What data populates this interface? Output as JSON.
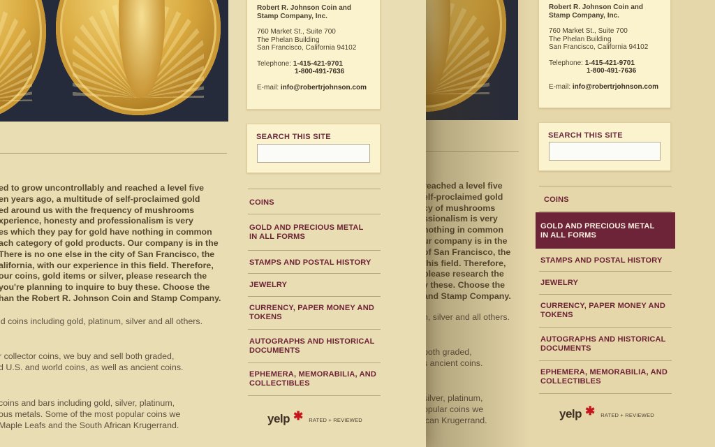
{
  "contact": {
    "company": "Robert R. Johnson Coin and Stamp Company, Inc.",
    "address_line1": "760 Market St., Suite 700",
    "address_line2": "The Phelan Building",
    "address_line3": "San Francisco, California 94102",
    "telephone_label": "Telephone:",
    "phone1": "1-415-421-9701",
    "phone2": "1-800-491-7636",
    "email_label": "E-mail:",
    "email": "info@robertrjohnson.com"
  },
  "search": {
    "title": "SEARCH THIS SITE",
    "placeholder": ""
  },
  "nav": {
    "items": [
      {
        "line1": "COINS",
        "line2": ""
      },
      {
        "line1": "GOLD AND PRECIOUS METAL",
        "line2": "IN ALL FORMS"
      },
      {
        "line1": "STAMPS AND POSTAL HISTORY",
        "line2": ""
      },
      {
        "line1": "JEWELRY",
        "line2": ""
      },
      {
        "line1": "CURRENCY, PAPER MONEY AND",
        "line2": "TOKENS"
      },
      {
        "line1": "AUTOGRAPHS AND HISTORICAL",
        "line2": "DOCUMENTS"
      },
      {
        "line1": "EPHEMERA, MEMORABILIA, AND",
        "line2": "COLLECTIBLES"
      }
    ],
    "active_index_right": 1
  },
  "yelp": {
    "logo_text": "yelp",
    "burst": "✱",
    "tag": "RATED + REVIEWED"
  },
  "left_body": {
    "para1": [
      "ed to grow uncontrollably and reached a level five",
      "en years ago, a multitude of self-proclaimed gold",
      "ed around us with the frequency of mushrooms",
      "xperience, honesty and professionalism is very",
      "es which they pay for gold have nothing in common",
      "ach category of gold products. Our company is in the",
      "There is no one else in the city of San Francisco, the",
      "alifornia, with our experience in this field. Therefore,",
      "our coins, gold items or silver, please research the",
      "you're planning to inquire to buy these. Choose the",
      "han the Robert R. Johnson Coin and Stamp Company."
    ],
    "para2": [
      "ld coins including gold, platinum, silver and all others."
    ],
    "para3": [
      "r collector coins, we buy and sell both graded,",
      "d U.S. and world coins, as well as ancient coins."
    ],
    "para4": [
      "coins and bars including gold, silver, platinum,",
      "ous metals. Some of the most popular coins we",
      "Maple Leafs and the South African Krugerrand."
    ]
  },
  "right_body": {
    "para1": [
      "reached a level five",
      "elf-proclaimed gold",
      "cy of mushrooms",
      "ssionalism is very",
      "nothing in common",
      "ur company is in the",
      "of San Francisco, the",
      "this field. Therefore,",
      "please research the",
      "y these. Choose the",
      "and Stamp Company."
    ],
    "para2": [
      "n, silver and all others."
    ],
    "para3": [
      "both graded,",
      "s ancient coins."
    ],
    "para4": [
      "silver, platinum,",
      "opular coins we",
      "ican Krugerrand."
    ]
  },
  "colors": {
    "page_bg": "#e9ddb3",
    "card_bg": "#fbf2ce",
    "nav_text": "#6e2236",
    "nav_active_bg": "#6e2438",
    "body_text": "#5c5140"
  }
}
